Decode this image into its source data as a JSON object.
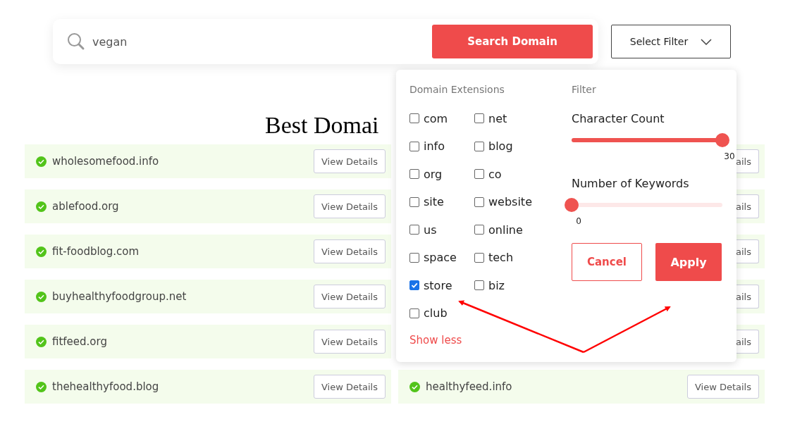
{
  "search": {
    "value": "vegan",
    "button": "Search Domain"
  },
  "filter_button": {
    "label": "Select Filter"
  },
  "heading": "Best Domai",
  "results_left": [
    {
      "domain": "wholesomefood.info",
      "button": "View Details"
    },
    {
      "domain": "ablefood.org",
      "button": "View Details"
    },
    {
      "domain": "fit-foodblog.com",
      "button": "View Details"
    },
    {
      "domain": "buyhealthyfoodgroup.net",
      "button": "View Details"
    },
    {
      "domain": "fitfeed.org",
      "button": "View Details"
    },
    {
      "domain": "thehealthyfood.blog",
      "button": "View Details"
    }
  ],
  "results_right": [
    {
      "button": "ails"
    },
    {
      "button": "ails"
    },
    {
      "button": "ails"
    },
    {
      "button": "ails"
    },
    {
      "button": "ails"
    },
    {
      "domain": "healthyfeed.info",
      "button": "View Details"
    }
  ],
  "filter_panel": {
    "extensions_title": "Domain Extensions",
    "filter_title": "Filter",
    "extensions": [
      {
        "label": "com",
        "checked": false
      },
      {
        "label": "net",
        "checked": false
      },
      {
        "label": "info",
        "checked": false
      },
      {
        "label": "blog",
        "checked": false
      },
      {
        "label": "org",
        "checked": false
      },
      {
        "label": "co",
        "checked": false
      },
      {
        "label": "site",
        "checked": false
      },
      {
        "label": "website",
        "checked": false
      },
      {
        "label": "us",
        "checked": false
      },
      {
        "label": "online",
        "checked": false
      },
      {
        "label": "space",
        "checked": false
      },
      {
        "label": "tech",
        "checked": false
      },
      {
        "label": "store",
        "checked": true
      },
      {
        "label": "biz",
        "checked": false
      },
      {
        "label": "club",
        "checked": false
      }
    ],
    "show_less": "Show less",
    "sliders": [
      {
        "label": "Character Count",
        "level": 1,
        "reading": "30"
      },
      {
        "label": "Number of Keywords",
        "level": 0,
        "reading": "0"
      }
    ],
    "cancel": "Cancel",
    "apply": "Apply"
  }
}
